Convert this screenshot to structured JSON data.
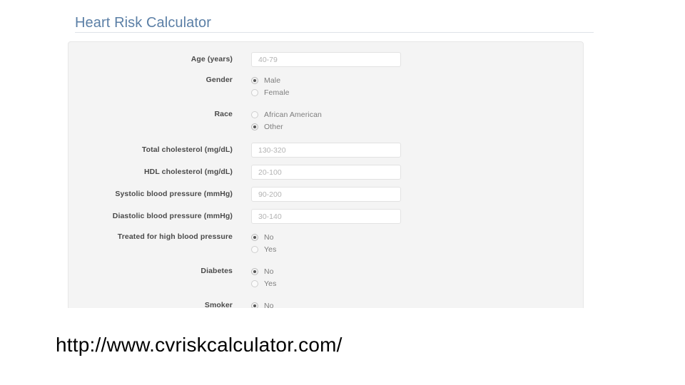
{
  "slide": {
    "background_color": "#ffffff",
    "url_caption": "http://www.cvriskcalculator.com/"
  },
  "header": {
    "title": "Heart Risk Calculator",
    "title_color": "#5b7fa6",
    "rule_color": "#dfe3e8"
  },
  "form": {
    "panel_background": "#f4f4f4",
    "rows": [
      {
        "label": "Age (years)",
        "type": "text",
        "value": "",
        "placeholder": "40-79"
      },
      {
        "label": "Gender",
        "type": "radio",
        "options": [
          {
            "label": "Male",
            "selected": true
          },
          {
            "label": "Female",
            "selected": false
          }
        ]
      },
      {
        "label": "Race",
        "type": "radio",
        "options": [
          {
            "label": "African American",
            "selected": false
          },
          {
            "label": "Other",
            "selected": true
          }
        ]
      },
      {
        "label": "Total cholesterol (mg/dL)",
        "type": "text",
        "value": "",
        "placeholder": "130-320"
      },
      {
        "label": "HDL cholesterol (mg/dL)",
        "type": "text",
        "value": "",
        "placeholder": "20-100"
      },
      {
        "label": "Systolic blood pressure (mmHg)",
        "type": "text",
        "value": "",
        "placeholder": "90-200"
      },
      {
        "label": "Diastolic blood pressure (mmHg)",
        "type": "text",
        "value": "",
        "placeholder": "30-140"
      },
      {
        "label": "Treated for high blood pressure",
        "type": "radio",
        "options": [
          {
            "label": "No",
            "selected": true
          },
          {
            "label": "Yes",
            "selected": false
          }
        ]
      },
      {
        "label": "Diabetes",
        "type": "radio",
        "options": [
          {
            "label": "No",
            "selected": true
          },
          {
            "label": "Yes",
            "selected": false
          }
        ]
      },
      {
        "label": "Smoker",
        "type": "radio",
        "options": [
          {
            "label": "No",
            "selected": true
          }
        ]
      }
    ]
  }
}
